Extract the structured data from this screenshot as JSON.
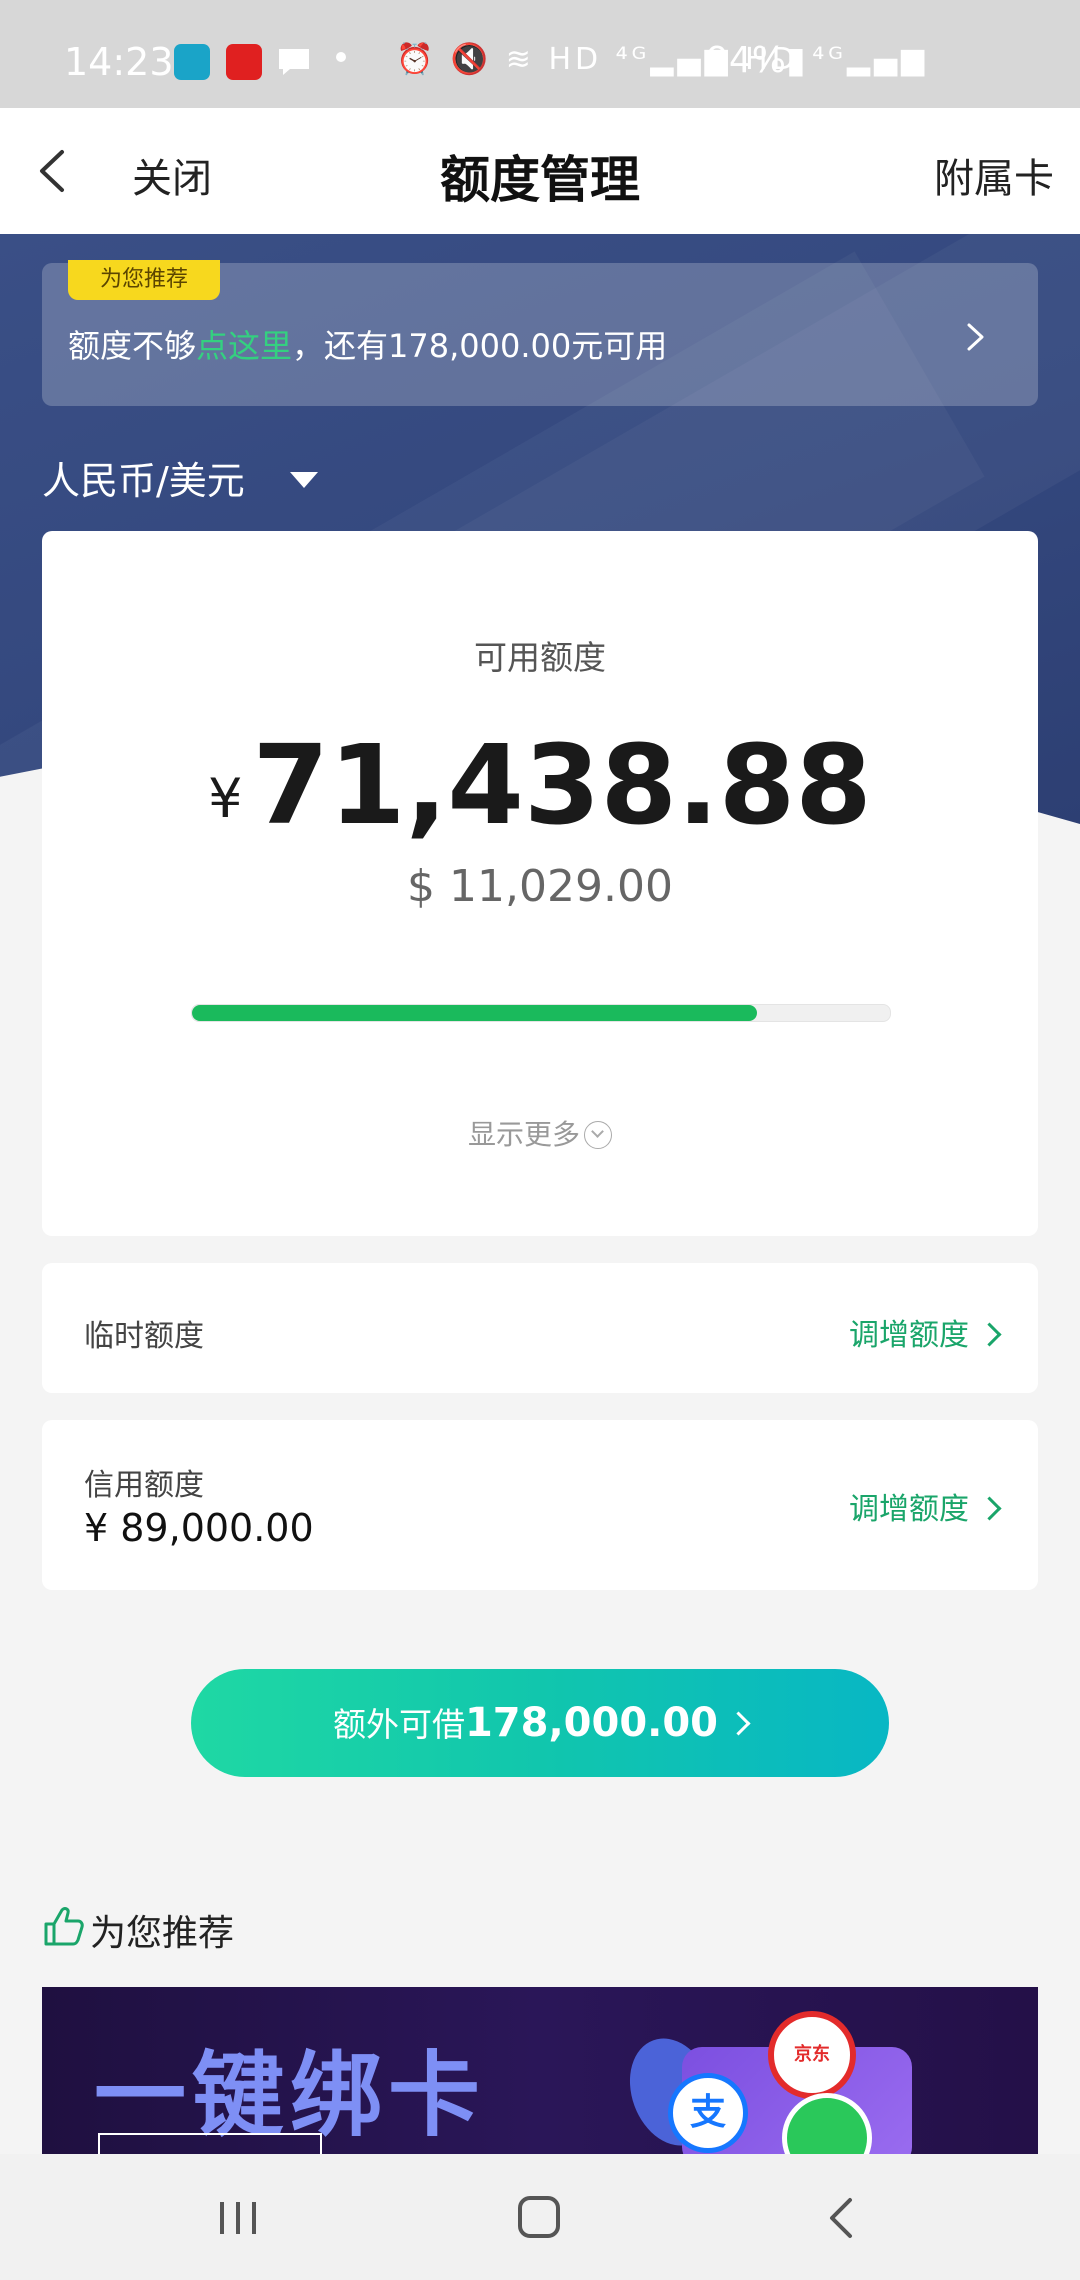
{
  "status_bar": {
    "time": "14:23",
    "signal_text": "⏰ 🔇 ≋ HD ⁴ᴳ▂▄▆ HD ⁴ᴳ▂▄▆",
    "battery": "94%▮"
  },
  "nav": {
    "back_icon": "chevron-left-icon",
    "close_label": "关闭",
    "title": "额度管理",
    "sub_card_label": "附属卡"
  },
  "promo": {
    "tag": "为您推荐",
    "text_before": "额度不够",
    "text_highlight": "点这里",
    "text_after": "，还有178,000.00元可用",
    "highlight_color": "#34d080"
  },
  "currency_selector": {
    "label": "人民币/美元"
  },
  "available": {
    "label": "可用额度",
    "cny_symbol": "¥",
    "cny_amount": "71,438.88",
    "usd_amount": "$ 11,029.00",
    "usage_fraction": 0.81,
    "show_more": "显示更多"
  },
  "temp_limit": {
    "label": "临时额度",
    "action": "调增额度"
  },
  "credit_limit": {
    "label": "信用额度",
    "value": "¥ 89,000.00",
    "action": "调增额度"
  },
  "extra_borrow": {
    "label": "额外可借",
    "value": "178,000.00"
  },
  "recommend": {
    "title": "为您推荐",
    "banner_text": "一键绑卡",
    "jd_label": "京东",
    "ali_label": "支"
  },
  "colors": {
    "accent_green": "#1aba5c",
    "link_green": "#1aa56a",
    "header_blue": "#34487e"
  }
}
